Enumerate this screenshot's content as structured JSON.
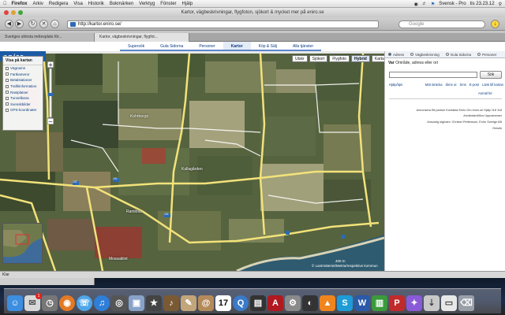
{
  "menubar": {
    "app_name": "Firefox",
    "items": [
      "Arkiv",
      "Redigera",
      "Visa",
      "Historik",
      "Bokmärken",
      "Verktyg",
      "Fönster",
      "Hjälp"
    ],
    "input_source": "Svensk - Pro",
    "clock": "tis 23.23.12"
  },
  "window": {
    "title": "Kartor, vägbeskrivningar, flygfoton, sjökort & mycket mer på eniro.se"
  },
  "toolbar": {
    "url": "http://kartor.eniro.se/",
    "search_placeholder": "Google"
  },
  "tabs": [
    {
      "label": "Sveriges största mötesplats för...",
      "active": false
    },
    {
      "label": "Kartor, vägbeskrivningar, flygfot...",
      "active": true
    }
  ],
  "site_nav": [
    {
      "label": "Supersök",
      "active": false
    },
    {
      "label": "Gula Sidorna",
      "active": false
    },
    {
      "label": "Personer",
      "active": false
    },
    {
      "label": "Kartor",
      "active": true
    },
    {
      "label": "Köp & Sälj",
      "active": false
    },
    {
      "label": "Alla tjänster",
      "active": false
    }
  ],
  "logo": "eniro",
  "left_panel": {
    "title": "Visa på kartan",
    "layers": [
      "Vägnamn",
      "Fartkameror",
      "Betalstationer",
      "Trafikinformation",
      "Rastplatser",
      "Tunnelbana",
      "Svenskbilder",
      "GPS-koordinater"
    ]
  },
  "map_controls": {
    "buttons": [
      {
        "label": "Utskr",
        "active": false
      },
      {
        "label": "Sjökort",
        "active": false
      },
      {
        "label": "Flygfoto",
        "active": false
      },
      {
        "label": "Hybrid",
        "active": true
      },
      {
        "label": "Karta",
        "active": false
      }
    ]
  },
  "map": {
    "places": [
      "Kohrbergs",
      "Kullagården",
      "Ramlösa",
      "Mossaklint"
    ],
    "road_numbers": [
      "101",
      "101",
      "101"
    ],
    "scale_label": "400 m",
    "copyright": "© Lantmäteriet/Metria/respektive kommun"
  },
  "sidebar": {
    "tabs": [
      {
        "label": "Adress",
        "active": true
      },
      {
        "label": "Vägbeskrivning",
        "active": false
      },
      {
        "label": "Gula Sidorna",
        "active": false
      },
      {
        "label": "Personer",
        "active": false
      }
    ],
    "label_bold": "Var",
    "label_rest": "Område, adress eller ort",
    "search_button": "Sök",
    "links": [
      "Hjälp/tips",
      "Mät sträcka",
      "Skriv ut",
      "Sms",
      "E-post",
      "Länk till kartan"
    ],
    "feedback_link": "Anmäl fel",
    "footer_lines": [
      "Annonsera  Bli partner  Kontakta Eniro  Om eniro.se  Hjälp  118 118",
      "Användarvillkor  Uppvaranser",
      "Ansvarig utgivare: Christer Pettersson, Eniro Sverige AB",
      "Omsök"
    ]
  },
  "statusbar": {
    "text": "Klar"
  },
  "dock": {
    "calendar_day": "17",
    "mail_badge": "1"
  },
  "colors": {
    "eniro_blue": "#1c5aa6",
    "road_yellow": "#f2e27a",
    "link_blue": "#0a3c84"
  }
}
